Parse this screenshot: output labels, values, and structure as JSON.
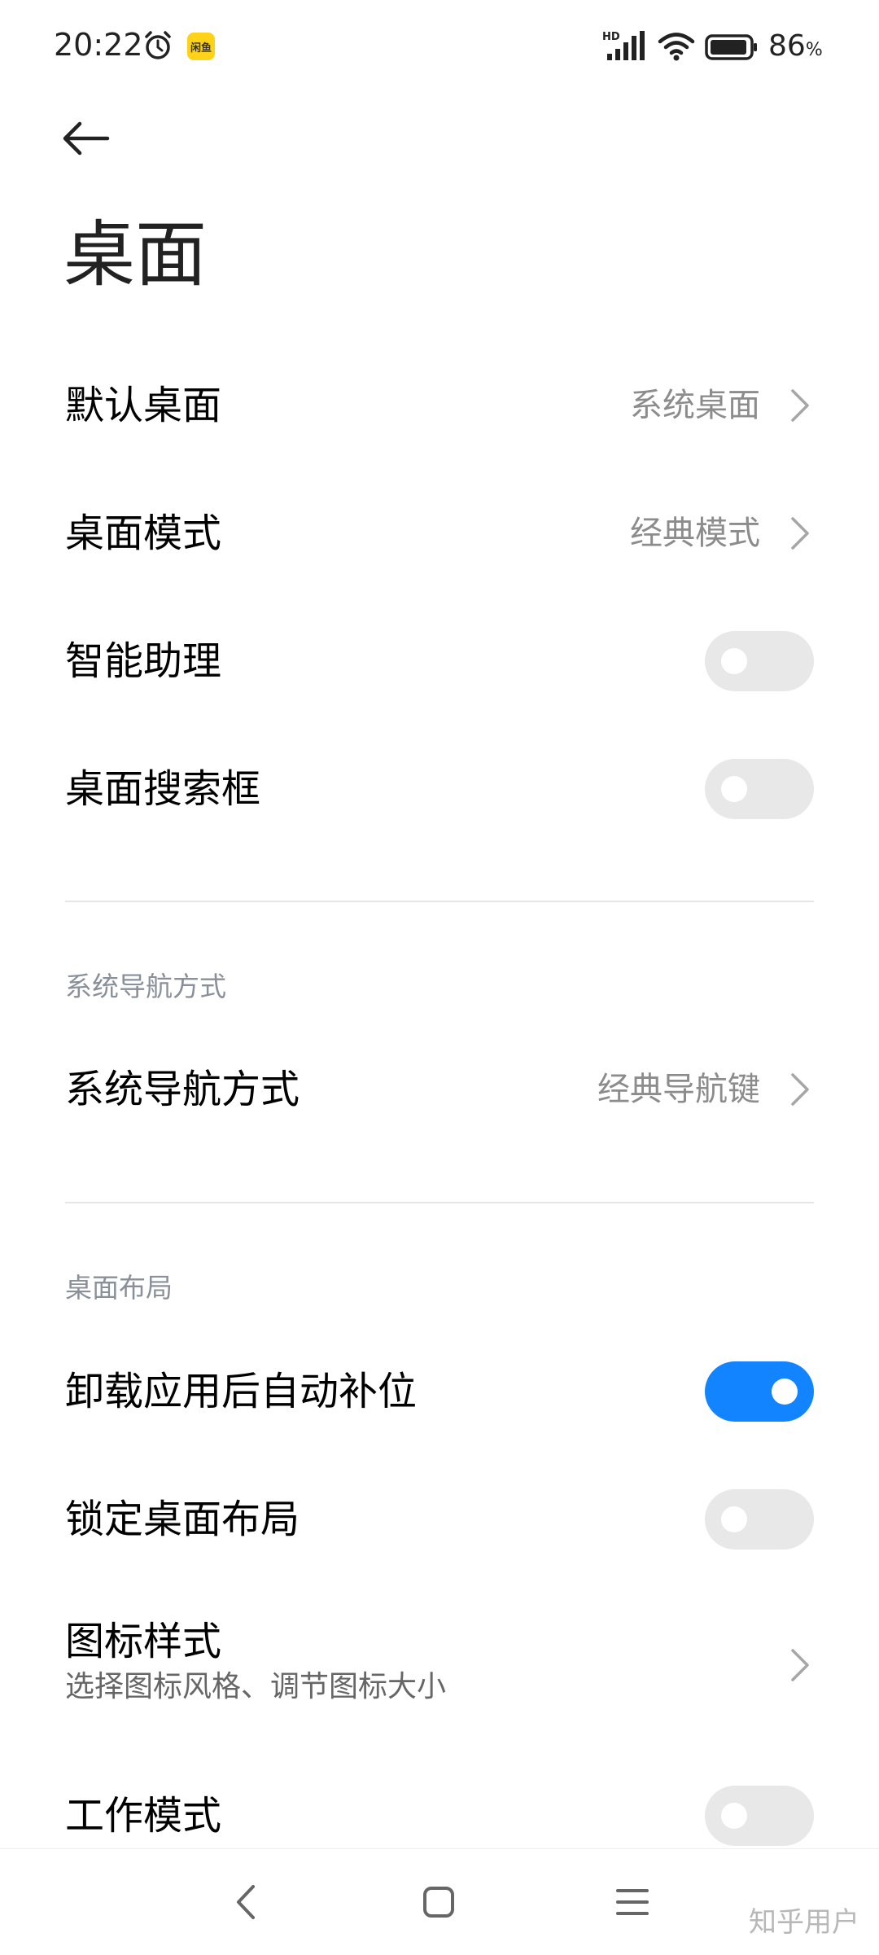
{
  "status_bar": {
    "time": "20:22",
    "app_badge": "闲鱼",
    "hd": "HD",
    "battery_value": "86",
    "battery_unit": "%"
  },
  "header": {
    "title": "桌面"
  },
  "settings": [
    {
      "label": "默认桌面",
      "value": "系统桌面",
      "type": "link"
    },
    {
      "label": "桌面模式",
      "value": "经典模式",
      "type": "link"
    },
    {
      "label": "智能助理",
      "type": "toggle",
      "on": false
    },
    {
      "label": "桌面搜索框",
      "type": "toggle",
      "on": false
    }
  ],
  "nav_section": {
    "header": "系统导航方式",
    "items": [
      {
        "label": "系统导航方式",
        "value": "经典导航键",
        "type": "link"
      }
    ]
  },
  "layout_section": {
    "header": "桌面布局",
    "items": [
      {
        "label": "卸载应用后自动补位",
        "type": "toggle",
        "on": true
      },
      {
        "label": "锁定桌面布局",
        "type": "toggle",
        "on": false
      },
      {
        "label": "图标样式",
        "sublabel": "选择图标风格、调节图标大小",
        "type": "link"
      },
      {
        "label": "工作模式",
        "type": "toggle",
        "on": false
      }
    ]
  },
  "watermark": "知乎用户",
  "colors": {
    "accent": "#1384ff",
    "toggle_off": "#e8e8e8",
    "secondary_text": "#8c8c8c",
    "section_header": "#8a9099"
  }
}
